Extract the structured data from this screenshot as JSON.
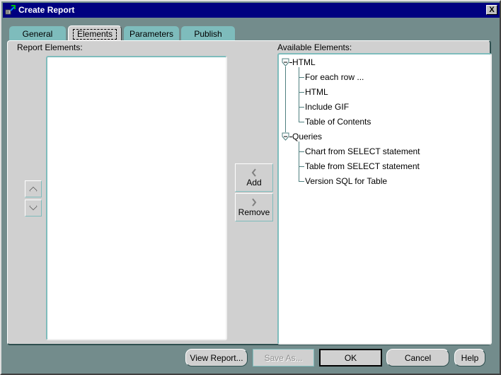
{
  "window": {
    "title": "Create Report",
    "app_icon": "tools-icon",
    "close_icon": "close-icon",
    "close_glyph": "X"
  },
  "tabs": [
    {
      "label": "General",
      "active": false
    },
    {
      "label": "Elements",
      "active": true
    },
    {
      "label": "Parameters",
      "active": false
    },
    {
      "label": "Publish",
      "active": false
    }
  ],
  "report_elements": {
    "label": "Report Elements:",
    "items": [],
    "move_up_icon": "chevron-up-icon",
    "move_down_icon": "chevron-down-icon"
  },
  "transfer": {
    "add_label": "Add",
    "add_icon": "chevron-left-icon",
    "remove_label": "Remove",
    "remove_icon": "chevron-right-icon"
  },
  "available_elements": {
    "label": "Available Elements:",
    "tree": [
      {
        "label": "HTML",
        "expanded": true,
        "children": [
          "For each row ...",
          "HTML",
          "Include GIF",
          "Table of Contents"
        ]
      },
      {
        "label": "Queries",
        "expanded": true,
        "children": [
          "Chart from SELECT statement",
          "Table from SELECT statement",
          "Version SQL for Table"
        ]
      }
    ]
  },
  "buttons": {
    "view_report": "View Report...",
    "save_as": "Save As...",
    "ok": "OK",
    "cancel": "Cancel",
    "help": "Help"
  },
  "colors": {
    "title_bar": "#000080",
    "tab_inactive": "#7ebcbc",
    "frame": "#738c8c",
    "panel": "#d0d0d0"
  }
}
